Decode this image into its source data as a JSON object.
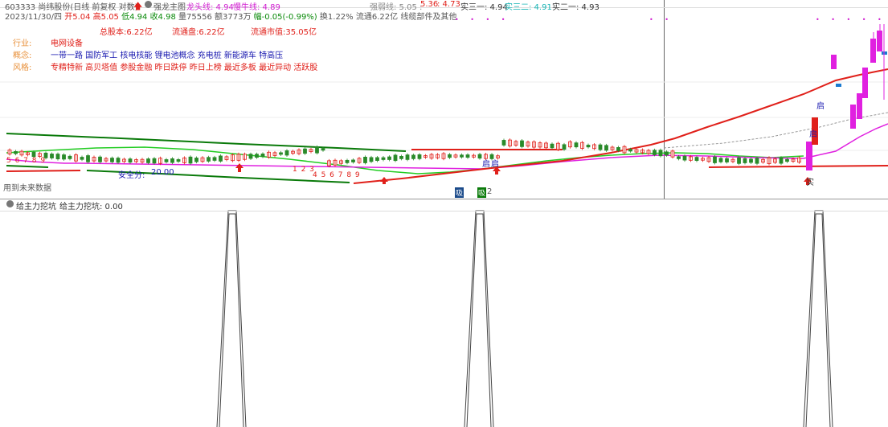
{
  "header": {
    "code_title": "603333 尚纬股份(日线 前复权 对数)",
    "indicator_name": "强龙主图",
    "longtou_label": "龙头线: 4.94",
    "niuxian_label": "慢牛线: 4.89",
    "qiangruo_label": "强弱线: 5.05 :",
    "val_536": "5.36",
    "val_473": ": 4.73",
    "shi_a": "实三一: 4.94",
    "shi_b": "实三二: 4.91",
    "shi_c": "实二一: 4.93",
    "date": "2023/11/30/四",
    "open": "开5.04",
    "high": "高5.05",
    "low": "低4.94",
    "close": "收4.98",
    "volume": "量75556",
    "amount": "额3773万",
    "change": "幅-0.05(-0.99%)",
    "turnover": "换1.22%",
    "float_mv": "流通6.22亿",
    "extra": "线缆部件及其他"
  },
  "info": {
    "total_shares": "总股本:6.22亿",
    "float_shares": "流通盘:6.22亿",
    "float_value": "流通市值:35.05亿",
    "industry_label": "行业:",
    "industry_value": "电网设备",
    "concept_label": "概念:",
    "concept_value": "一带一路 国防军工 核电核能 锂电池概念 充电桩 新能源车 特高压",
    "style_label": "风格:",
    "style_value": "专精特新 高贝塔值 参股金融 昨日跌停 昨日上榜 最近多板 最近异动 活跃股"
  },
  "chart_marks": {
    "safe_label": "安全分:",
    "safe_value": "20.00",
    "future_data": "用到未来数据",
    "seq_left": "5 6 7 8 9",
    "seq_mid1": "1 2 3",
    "seq_mid2": "4 5 6 7 8 9",
    "qi1": "启",
    "qi2": "启",
    "qi3": "启",
    "qi4": "启",
    "shi_mark": "实",
    "box1": "吸",
    "box2": "吸",
    "box_num": "2"
  },
  "sub_panel": {
    "title": "给主力挖坑",
    "value_label": "给主力挖坑: 0.00"
  },
  "colors": {
    "red": "#e0201a",
    "green_line": "#22cc22",
    "dark_green": "#0a7a0a",
    "magenta": "#e020e0",
    "blue_text": "#1a1ab0",
    "orange_label": "#e8903a"
  }
}
